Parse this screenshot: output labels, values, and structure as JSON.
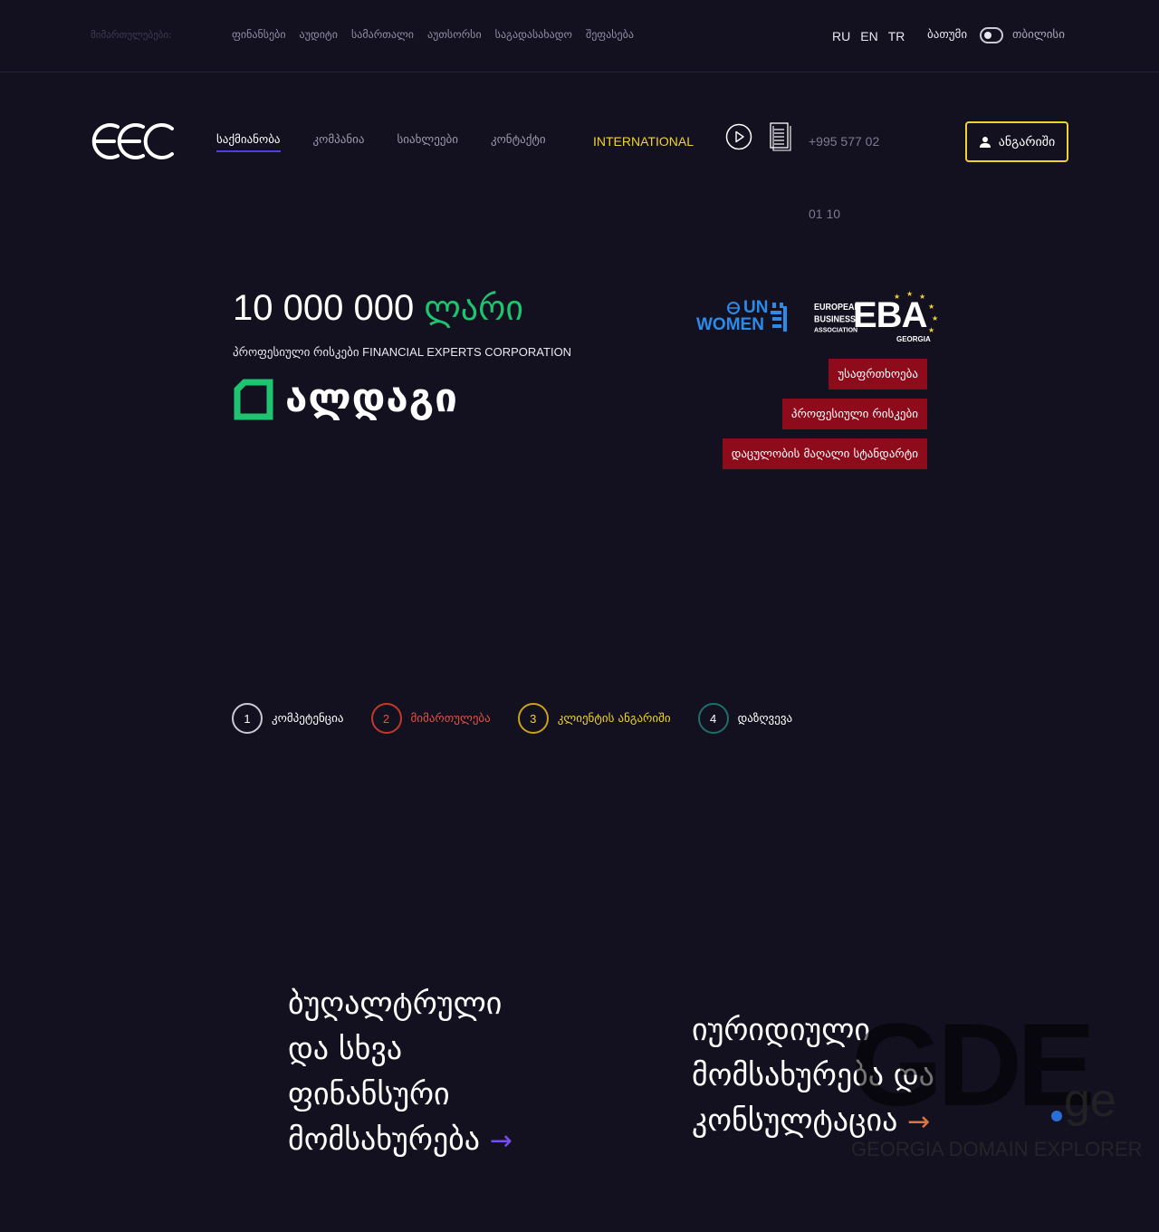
{
  "topbar": {
    "directions_label": "მიმართულებები:",
    "directions": [
      "ფინანსები",
      "აუდიტი",
      "სამართალი",
      "აუთსორსი",
      "საგადასახადო",
      "შეფასება"
    ],
    "languages": [
      "RU",
      "EN",
      "TR"
    ],
    "city_left": "ბათუმი",
    "city_right": "თბილისი"
  },
  "header": {
    "nav": [
      "საქმიანობა",
      "კომპანია",
      "სიახლეები",
      "კონტაქტი"
    ],
    "international": "INTERNATIONAL",
    "phone_line1": "+995 577 02",
    "phone_line2": "01 10",
    "account_label": "ანგარიში"
  },
  "hero": {
    "amount_number": "10 000 000",
    "amount_currency": "ლარი",
    "subtitle": "პროფესიული რისკები FINANCIAL EXPERTS CORPORATION",
    "partner_name": "ალდაგი",
    "un_women_top": "UN",
    "un_women_bottom": "WOMEN",
    "eba_small": [
      "EUROPEAN",
      "BUSINESS",
      "ASSOCIATION"
    ],
    "eba_big": "EBA",
    "eba_country": "GEORGIA",
    "tags": [
      "უსაფრთხოება",
      "პროფესიული რისკები",
      "დაცულობის მაღალი სტანდარტი"
    ],
    "colors": {
      "currency": "#1fc470",
      "tag_bg": "#8e0b1c",
      "accent_yellow": "#f2d230"
    }
  },
  "steps": [
    {
      "num": "1",
      "label": "კომპეტენცია",
      "color": "#c9c9d6",
      "label_color": "#ffffff"
    },
    {
      "num": "2",
      "label": "მიმართულება",
      "color": "#c0392b",
      "label_color": "#e0533d"
    },
    {
      "num": "3",
      "label": "კლიენტის ანგარიში",
      "color": "#c9a21c",
      "label_color": "#f2d230"
    },
    {
      "num": "4",
      "label": "დაზღვევა",
      "color": "#1f6e6a",
      "label_color": "#ffffff"
    }
  ],
  "services": {
    "first": [
      "ბუღალტრული",
      "და სხვა",
      "ფინანსური",
      "მომსახურება"
    ],
    "second": [
      "იურიდიული",
      "მომსახურება და",
      "კონსულტაცია"
    ]
  },
  "watermark": {
    "big": "GDE",
    "tld": "ge",
    "caption": "GEORGIA DOMAIN EXPLORER"
  },
  "icons": {
    "logo": "eec-logo",
    "play": "play-circle-icon",
    "document": "document-icon",
    "account": "user-icon",
    "arrow": "arrow-right-icon"
  }
}
